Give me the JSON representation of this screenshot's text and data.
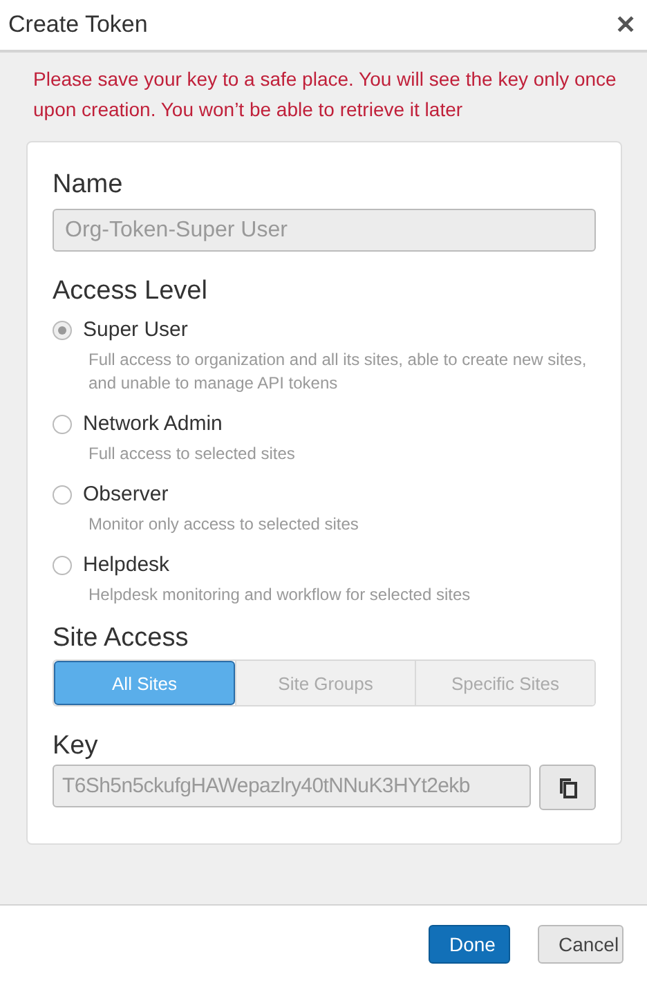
{
  "window": {
    "title": "Create Token",
    "close": "✕"
  },
  "warning": "Please save your key to a safe place. You will see the key only once upon creation. You won’t be able to retrieve it later",
  "name": {
    "label": "Name",
    "value": "Org-Token-Super User",
    "disabled": true
  },
  "access_level": {
    "label": "Access Level",
    "options": [
      {
        "label": "Super User",
        "description": "Full access to organization and all its sites, able to create new sites, and unable to manage API tokens",
        "selected": true
      },
      {
        "label": "Network Admin",
        "description": "Full access to selected sites",
        "selected": false
      },
      {
        "label": "Observer",
        "description": "Monitor only access to selected sites",
        "selected": false
      },
      {
        "label": "Helpdesk",
        "description": "Helpdesk monitoring and workflow for selected sites",
        "selected": false
      }
    ]
  },
  "site_access": {
    "label": "Site Access",
    "tabs": [
      {
        "label": "All Sites",
        "selected": true
      },
      {
        "label": "Site Groups",
        "selected": false
      },
      {
        "label": "Specific Sites",
        "selected": false
      }
    ]
  },
  "key": {
    "label": "Key",
    "value": "T6Sh5n5ckufgHAWepazlry40tNNuK3HYt2ekb"
  },
  "buttons": [
    {
      "label": "Done",
      "kind": "primary"
    },
    {
      "label": "Cancel",
      "kind": "secondary"
    }
  ]
}
